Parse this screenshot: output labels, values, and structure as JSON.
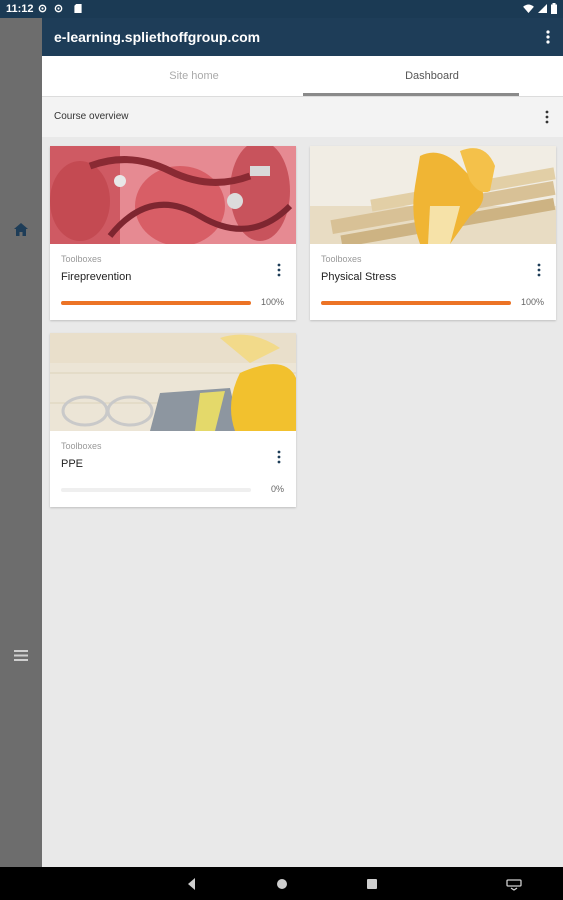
{
  "status_bar": {
    "time": "11:12"
  },
  "app_bar": {
    "title": "e-learning.spliethoffgroup.com"
  },
  "tabs": [
    {
      "label": "Site home",
      "active": false
    },
    {
      "label": "Dashboard",
      "active": true
    }
  ],
  "overview": {
    "label": "Course overview"
  },
  "courses": [
    {
      "category": "Toolboxes",
      "name": "Fireprevention",
      "progress_pct": 100,
      "progress_label": "100%",
      "image": "fire-extinguishers-image"
    },
    {
      "category": "Toolboxes",
      "name": "Physical Stress",
      "progress_pct": 100,
      "progress_label": "100%",
      "image": "gloves-lumber-image"
    },
    {
      "category": "Toolboxes",
      "name": "PPE",
      "progress_pct": 0,
      "progress_label": "0%",
      "image": "safety-gear-image"
    }
  ],
  "colors": {
    "app_bar": "#1e3d58",
    "progress": "#ec7325",
    "side_rail": "#6d6d6d",
    "background": "#e9e9e9"
  }
}
